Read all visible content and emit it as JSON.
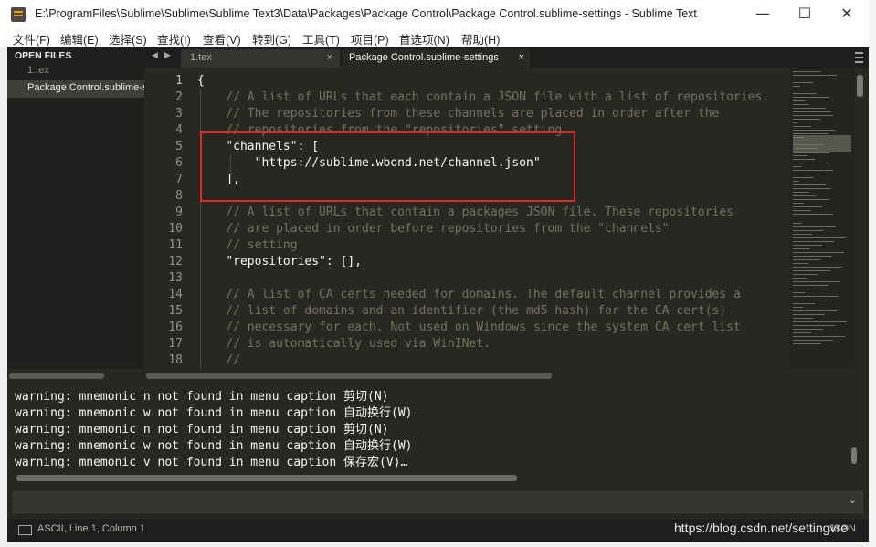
{
  "window": {
    "title": "E:\\ProgramFiles\\Sublime\\Sublime\\Sublime Text3\\Data\\Packages\\Package Control\\Package Control.sublime-settings - Sublime Text",
    "minimize": "—",
    "maximize": "☐",
    "close": "✕"
  },
  "menu": [
    "文件(F)",
    "编辑(E)",
    "选择(S)",
    "查找(I)",
    "查看(V)",
    "转到(G)",
    "工具(T)",
    "项目(P)",
    "首选项(N)",
    "帮助(H)"
  ],
  "sidebar": {
    "header": "OPEN FILES",
    "files": [
      {
        "label": "1.tex",
        "active": false
      },
      {
        "label": "Package Control.sublime-settings",
        "active": true
      }
    ]
  },
  "tabs": {
    "nav_left": "◀",
    "nav_right": "▶",
    "items": [
      {
        "label": "1.tex",
        "close": "×",
        "active": false
      },
      {
        "label": "Package Control.sublime-settings",
        "close": "×",
        "active": true
      }
    ]
  },
  "editor": {
    "line_numbers": [
      "1",
      "2",
      "3",
      "4",
      "5",
      "6",
      "7",
      "8",
      "9",
      "10",
      "11",
      "12",
      "13",
      "14",
      "15",
      "16",
      "17",
      "18"
    ],
    "lines": [
      [
        {
          "t": "{",
          "c": "p"
        }
      ],
      [
        {
          "t": "    // A list of URLs that each contain a JSON file with a list of repositories.",
          "c": "c"
        }
      ],
      [
        {
          "t": "    // The repositories from these channels are placed in order after the",
          "c": "c"
        }
      ],
      [
        {
          "t": "    // repositories from the \"repositories\" setting",
          "c": "c"
        }
      ],
      [
        {
          "t": "    ",
          "c": "p"
        },
        {
          "t": "\"channels\"",
          "c": "p"
        },
        {
          "t": ": [",
          "c": "p"
        }
      ],
      [
        {
          "t": "        ",
          "c": "p"
        },
        {
          "t": "\"https://sublime.wbond.net/channel.json\"",
          "c": "p"
        }
      ],
      [
        {
          "t": "    ],",
          "c": "p"
        }
      ],
      [
        {
          "t": "",
          "c": "p"
        }
      ],
      [
        {
          "t": "    // A list of URLs that contain a packages JSON file. These repositories",
          "c": "c"
        }
      ],
      [
        {
          "t": "    // are placed in order before repositories from the \"channels\"",
          "c": "c"
        }
      ],
      [
        {
          "t": "    // setting",
          "c": "c"
        }
      ],
      [
        {
          "t": "    ",
          "c": "p"
        },
        {
          "t": "\"repositories\"",
          "c": "p"
        },
        {
          "t": ": [],",
          "c": "p"
        }
      ],
      [
        {
          "t": "",
          "c": "p"
        }
      ],
      [
        {
          "t": "    // A list of CA certs needed for domains. The default channel provides a",
          "c": "c"
        }
      ],
      [
        {
          "t": "    // list of domains and an identifier (the md5 hash) for the CA cert(s)",
          "c": "c"
        }
      ],
      [
        {
          "t": "    // necessary for each. Not used on Windows since the system CA cert list",
          "c": "c"
        }
      ],
      [
        {
          "t": "    // is automatically used via WinINet.",
          "c": "c"
        }
      ],
      [
        {
          "t": "    //",
          "c": "c"
        }
      ]
    ]
  },
  "console": {
    "lines": [
      "warning: mnemonic n not found in menu caption 剪切(N)",
      "warning: mnemonic w not found in menu caption 自动换行(W)",
      "warning: mnemonic n not found in menu caption 剪切(N)",
      "warning: mnemonic w not found in menu caption 自动换行(W)",
      "warning: mnemonic v not found in menu caption 保存宏(V)…"
    ],
    "input_value": "",
    "input_chevron": "⌄"
  },
  "status": {
    "left": "ASCII, Line 1, Column 1",
    "right": "JSON"
  },
  "watermark": "https://blog.csdn.net/settingvre",
  "colors": {
    "background": "#272822",
    "comment": "#75715e",
    "text": "#f8f8f2",
    "highlight_box": "#e02a2a"
  }
}
